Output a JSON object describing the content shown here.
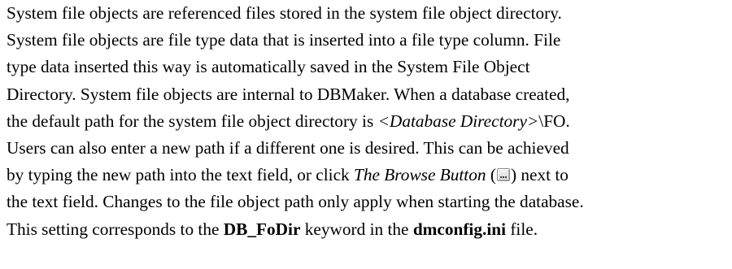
{
  "paragraph": {
    "l1": "System file objects are referenced files stored in the system file object directory.",
    "l2": "System file objects are file type data that is inserted into a file type column. File",
    "l3": "type data inserted this way is automatically saved in the System File Object",
    "l4": "Directory. System file objects are internal to DBMaker. When a database created,",
    "l5_a": "the default path for the system file object directory is ",
    "l5_em": "<Database Directory>",
    "l5_b": "\\FO.",
    "l6": "Users can also enter a new path if a different one is desired. This can be achieved",
    "l7": "by typing the new path into the text field, or click ",
    "l8_a": "by typing the new path into the text field, or click ",
    "l8_em": "The Browse Button",
    "l8_open": " (",
    "l8_close": ") next to",
    "l9": "the text field. Changes to the file object path only apply when starting the database.",
    "l10_a": "This setting corresponds to the ",
    "l10_kw": "DB_FoDir",
    "l10_b": " keyword in the ",
    "l10_file": "dmconfig.ini",
    "l10_c": " file."
  },
  "icons": {
    "browse_button": "browse-ellipsis-icon"
  }
}
